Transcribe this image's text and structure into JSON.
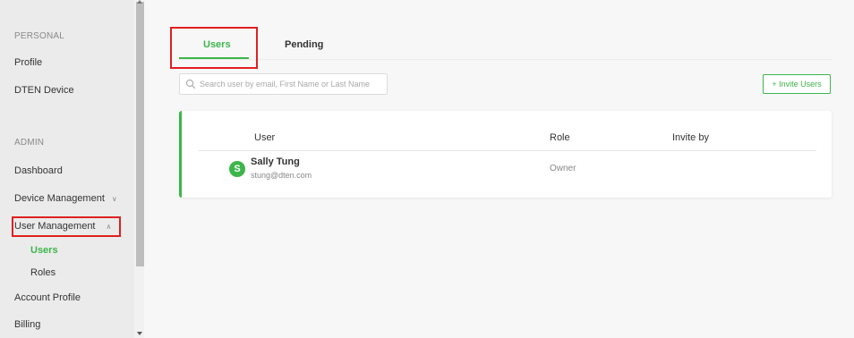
{
  "sidebar": {
    "personal_label": "PERSONAL",
    "profile": "Profile",
    "dten_device": "DTEN Device",
    "admin_label": "ADMIN",
    "dashboard": "Dashboard",
    "device_management": "Device Management",
    "user_management": "User Management",
    "users": "Users",
    "roles": "Roles",
    "account_profile": "Account Profile",
    "billing": "Billing",
    "chevron_down": "∨",
    "chevron_up": "∧"
  },
  "tabs": {
    "users": "Users",
    "pending": "Pending"
  },
  "search": {
    "placeholder": "Search user by email, First Name or Last Name"
  },
  "invite_button": "+ Invite Users",
  "table": {
    "headers": {
      "user": "User",
      "role": "Role",
      "invite_by": "Invite by"
    },
    "rows": [
      {
        "initial": "S",
        "name": "Sally Tung",
        "email": "stung@dten.com",
        "role": "Owner"
      }
    ]
  },
  "colors": {
    "accent": "#3cb54a",
    "highlight": "#e02020"
  }
}
